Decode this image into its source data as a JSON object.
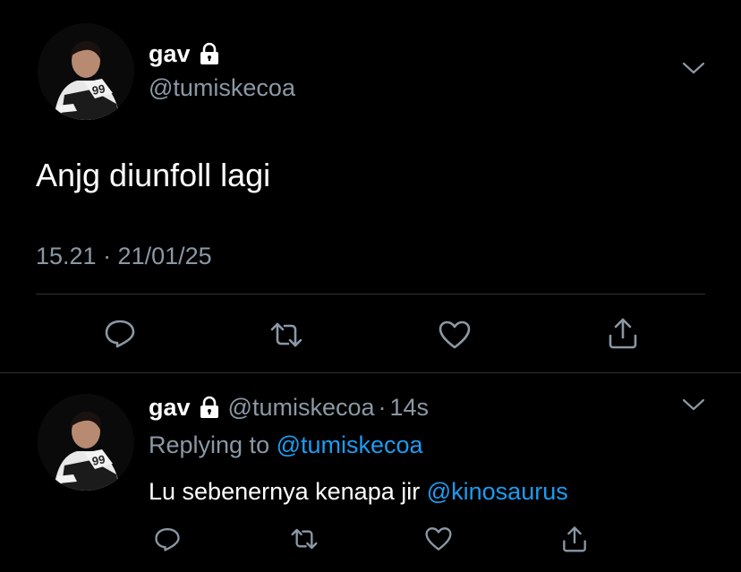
{
  "main_tweet": {
    "name": "gav",
    "handle": "@tumiskecoa",
    "text": "Anjg diunfoll lagi",
    "timestamp": "15.21 · 21/01/25",
    "icons": [
      "lock-icon",
      "chevron-down-icon",
      "reply-icon",
      "retweet-icon",
      "like-icon",
      "share-icon"
    ]
  },
  "reply_tweet": {
    "name": "gav",
    "handle": "@tumiskecoa",
    "separator": "·",
    "time": "14s",
    "replying_prefix": "Replying to",
    "replying_to": "@tumiskecoa",
    "text": "Lu sebenernya kenapa jir",
    "mention": "@kinosaurus"
  },
  "colors": {
    "background": "#000000",
    "text": "#ffffff",
    "secondary_text": "#8b98a5",
    "link": "#1d9bf0",
    "divider": "#2f3336"
  }
}
